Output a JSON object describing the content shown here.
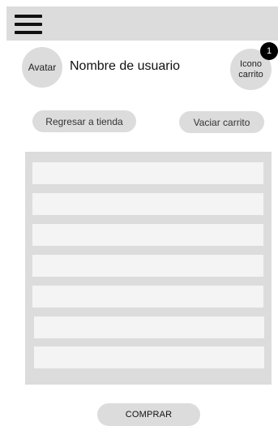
{
  "header": {
    "menu_icon": "hamburger-menu-icon"
  },
  "user": {
    "avatar_label": "Avatar",
    "username": "Nombre de usuario"
  },
  "cart": {
    "icon_label": "Icono carrito",
    "count": "1"
  },
  "actions": {
    "back_label": "Regresar a tienda",
    "clear_label": "Vaciar carrito",
    "buy_label": "COMPRAR"
  },
  "cart_items": [
    {
      "label": ""
    },
    {
      "label": ""
    },
    {
      "label": ""
    },
    {
      "label": ""
    },
    {
      "label": ""
    },
    {
      "label": ""
    },
    {
      "label": ""
    }
  ]
}
